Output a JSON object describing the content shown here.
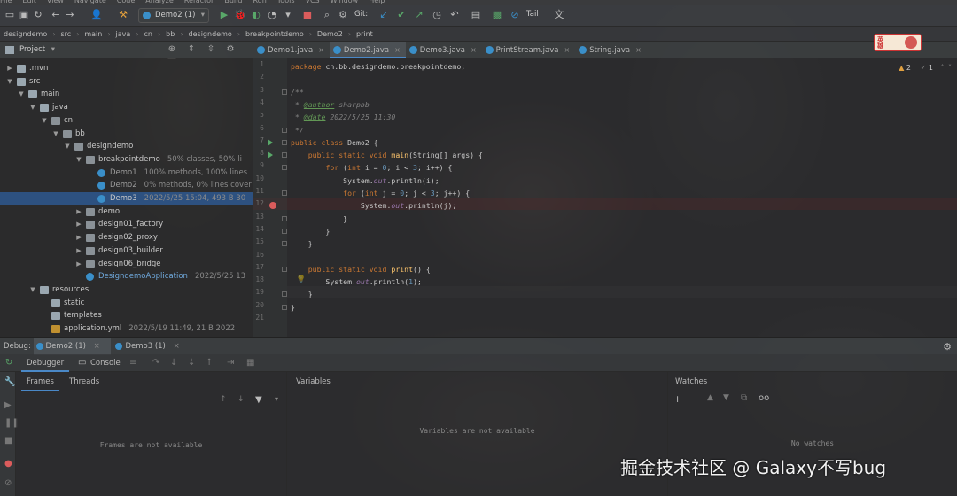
{
  "menubar": {
    "items": [
      "File",
      "Edit",
      "View",
      "Navigate",
      "Code",
      "Analyze",
      "Refactor",
      "Build",
      "Run",
      "Tools",
      "VCS",
      "Window",
      "Help"
    ]
  },
  "toolbar": {
    "run_config": "Demo2 (1)",
    "git_label": "Git:",
    "tail_label": "Tail"
  },
  "breadcrumb": [
    "designdemo",
    "src",
    "main",
    "java",
    "cn",
    "bb",
    "designdemo",
    "breakpointdemo",
    "Demo2",
    "print"
  ],
  "project": {
    "title": "Project"
  },
  "tabs": [
    {
      "label": "Demo1.java",
      "active": false
    },
    {
      "label": "Demo2.java",
      "active": true
    },
    {
      "label": "Demo3.java",
      "active": false
    },
    {
      "label": "PrintStream.java",
      "active": false
    },
    {
      "label": "String.java",
      "active": false
    }
  ],
  "tree": [
    {
      "name": ".mvn",
      "meta": "",
      "level": 1,
      "type": "folder",
      "arrow": "right"
    },
    {
      "name": "src",
      "meta": "",
      "level": 1,
      "type": "folder",
      "arrow": "down"
    },
    {
      "name": "main",
      "meta": "",
      "level": 2,
      "type": "folder",
      "arrow": "down"
    },
    {
      "name": "java",
      "meta": "",
      "level": 3,
      "type": "folder",
      "arrow": "down"
    },
    {
      "name": "cn",
      "meta": "",
      "level": 4,
      "type": "pkg",
      "arrow": "down"
    },
    {
      "name": "bb",
      "meta": "",
      "level": 5,
      "type": "pkg",
      "arrow": "down"
    },
    {
      "name": "designdemo",
      "meta": "",
      "level": 6,
      "type": "pkg",
      "arrow": "down"
    },
    {
      "name": "breakpointdemo",
      "meta": "50% classes, 50% li",
      "level": 7,
      "type": "pkg",
      "arrow": "down"
    },
    {
      "name": "Demo1",
      "meta": "100% methods, 100% lines",
      "level": 8,
      "type": "cls",
      "arrow": ""
    },
    {
      "name": "Demo2",
      "meta": "0% methods, 0% lines cover",
      "level": 8,
      "type": "cls",
      "arrow": ""
    },
    {
      "name": "Demo3",
      "meta": "2022/5/25 15:04, 493 B 30",
      "level": 8,
      "type": "cls",
      "arrow": "",
      "selected": true
    },
    {
      "name": "demo",
      "meta": "",
      "level": 7,
      "type": "pkg",
      "arrow": "right"
    },
    {
      "name": "design01_factory",
      "meta": "",
      "level": 7,
      "type": "pkg",
      "arrow": "right"
    },
    {
      "name": "design02_proxy",
      "meta": "",
      "level": 7,
      "type": "pkg",
      "arrow": "right"
    },
    {
      "name": "design03_builder",
      "meta": "",
      "level": 7,
      "type": "pkg",
      "arrow": "right"
    },
    {
      "name": "design06_bridge",
      "meta": "",
      "level": 7,
      "type": "pkg",
      "arrow": "right"
    },
    {
      "name": "DesigndemoApplication",
      "meta": "2022/5/25 13",
      "level": 7,
      "type": "cls",
      "arrow": ""
    },
    {
      "name": "resources",
      "meta": "",
      "level": 3,
      "type": "folder",
      "arrow": "down"
    },
    {
      "name": "static",
      "meta": "",
      "level": 4,
      "type": "folder",
      "arrow": ""
    },
    {
      "name": "templates",
      "meta": "",
      "level": 4,
      "type": "folder",
      "arrow": ""
    },
    {
      "name": "application.yml",
      "meta": "2022/5/19 11:49, 21 B 2022",
      "level": 4,
      "type": "yml",
      "arrow": ""
    }
  ],
  "editor": {
    "line_numbers": [
      "1",
      "2",
      "3",
      "4",
      "5",
      "6",
      "7",
      "8",
      "9",
      "10",
      "11",
      "12",
      "13",
      "14",
      "15",
      "16",
      "17",
      "18",
      "19",
      "20",
      "21"
    ],
    "inspections": {
      "warnings": "2",
      "infos": "1"
    },
    "lines": [
      [
        [
          "kw",
          "package "
        ],
        [
          "p",
          "cn.bb.designdemo.breakpointdemo;"
        ]
      ],
      [],
      [
        [
          "cm",
          "/**"
        ]
      ],
      [
        [
          "cm",
          " * "
        ],
        [
          "tag",
          "@author"
        ],
        [
          "cm",
          " sharpbb"
        ]
      ],
      [
        [
          "cm",
          " * "
        ],
        [
          "tag",
          "@date"
        ],
        [
          "cm",
          " 2022/5/25 11:30"
        ]
      ],
      [
        [
          "cm",
          " */"
        ]
      ],
      [
        [
          "kw",
          "public class "
        ],
        [
          "p",
          "Demo2 {"
        ]
      ],
      [
        [
          "p",
          "    "
        ],
        [
          "kw",
          "public static void "
        ],
        [
          "fn",
          "main"
        ],
        [
          "p",
          "(String[] args) {"
        ]
      ],
      [
        [
          "p",
          "        "
        ],
        [
          "kw",
          "for "
        ],
        [
          "p",
          "("
        ],
        [
          "kw",
          "int "
        ],
        [
          "p",
          "i = "
        ],
        [
          "num",
          "0"
        ],
        [
          "p",
          "; i < "
        ],
        [
          "num",
          "3"
        ],
        [
          "p",
          "; i++) {"
        ]
      ],
      [
        [
          "p",
          "            System."
        ],
        [
          "st",
          "out"
        ],
        [
          "p",
          ".println(i);"
        ]
      ],
      [
        [
          "p",
          "            "
        ],
        [
          "kw",
          "for "
        ],
        [
          "p",
          "("
        ],
        [
          "kw",
          "int "
        ],
        [
          "p",
          "j = "
        ],
        [
          "num",
          "0"
        ],
        [
          "p",
          "; j < "
        ],
        [
          "num",
          "3"
        ],
        [
          "p",
          "; j++) {"
        ]
      ],
      [
        [
          "p",
          "                System."
        ],
        [
          "st",
          "out"
        ],
        [
          "p",
          ".println(j);"
        ]
      ],
      [
        [
          "p",
          "            }"
        ]
      ],
      [
        [
          "p",
          "        }"
        ]
      ],
      [
        [
          "p",
          "    }"
        ]
      ],
      [],
      [
        [
          "p",
          "    "
        ],
        [
          "kw",
          "public static void "
        ],
        [
          "fn",
          "print"
        ],
        [
          "p",
          "() {"
        ]
      ],
      [
        [
          "p",
          "        System."
        ],
        [
          "st",
          "out"
        ],
        [
          "p",
          ".println("
        ],
        [
          "num",
          "1"
        ],
        [
          "p",
          ");"
        ]
      ],
      [
        [
          "p",
          "    }"
        ]
      ],
      [
        [
          "p",
          "}"
        ]
      ],
      []
    ]
  },
  "debug": {
    "label": "Debug:",
    "tabs": [
      "Demo2 (1)",
      "Demo3 (1)"
    ],
    "subtabs": [
      "Debugger",
      "Console"
    ],
    "frames_tabs": [
      "Frames",
      "Threads"
    ],
    "frames_empty": "Frames are not available",
    "variables_header": "Variables",
    "variables_empty": "Variables are not available",
    "watches_header": "Watches",
    "watches_empty": "No watches"
  },
  "logo": {
    "text": "英雄"
  },
  "watermark": "掘金技术社区 @ Galaxy不写bug"
}
